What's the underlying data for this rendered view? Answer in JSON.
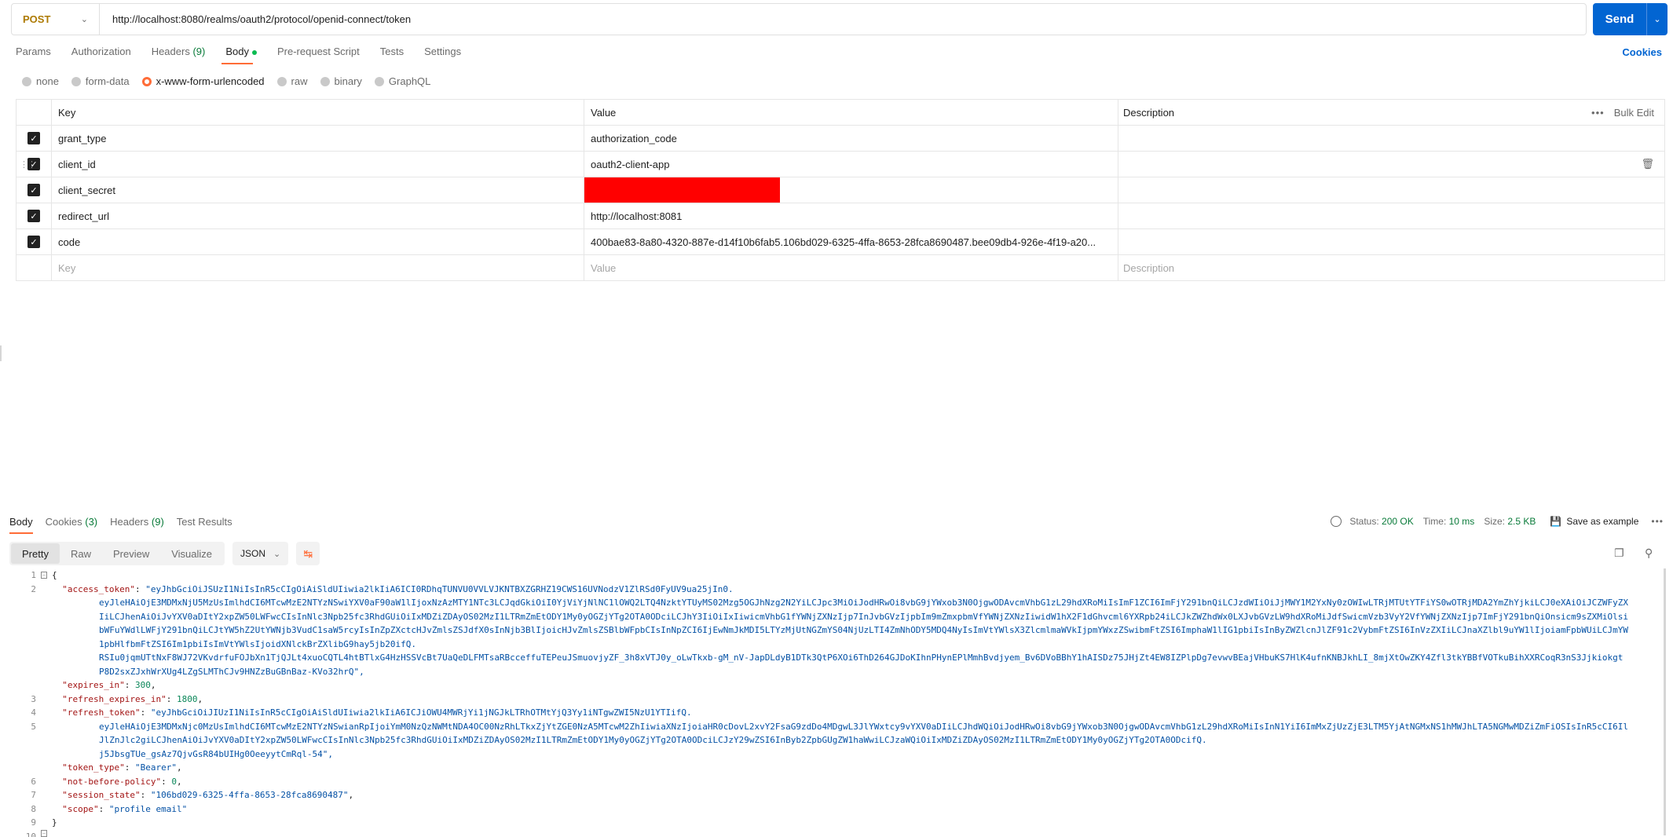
{
  "request": {
    "method": "POST",
    "url": "http://localhost:8080/realms/oauth2/protocol/openid-connect/token",
    "send_label": "Send"
  },
  "req_tabs": [
    {
      "label": "Params",
      "count": ""
    },
    {
      "label": "Authorization",
      "count": ""
    },
    {
      "label": "Headers",
      "count": "(9)"
    },
    {
      "label": "Body",
      "count": ""
    },
    {
      "label": "Pre-request Script",
      "count": ""
    },
    {
      "label": "Tests",
      "count": ""
    },
    {
      "label": "Settings",
      "count": ""
    }
  ],
  "cookies_label": "Cookies",
  "body_types": [
    "none",
    "form-data",
    "x-www-form-urlencoded",
    "raw",
    "binary",
    "GraphQL"
  ],
  "table": {
    "headers": {
      "key": "Key",
      "value": "Value",
      "description": "Description",
      "bulk_edit": "Bulk Edit"
    },
    "rows": [
      {
        "key": "grant_type",
        "value": "authorization_code",
        "description": ""
      },
      {
        "key": "client_id",
        "value": "oauth2-client-app",
        "description": ""
      },
      {
        "key": "client_secret",
        "value": "",
        "description": ""
      },
      {
        "key": "redirect_url",
        "value": "http://localhost:8081",
        "description": ""
      },
      {
        "key": "code",
        "value": "400bae83-8a80-4320-887e-d14f10b6fab5.106bd029-6325-4ffa-8653-28fca8690487.bee09db4-926e-4f19-a20...",
        "description": ""
      }
    ],
    "placeholders": {
      "key": "Key",
      "value": "Value",
      "description": "Description"
    }
  },
  "response": {
    "tabs": [
      {
        "label": "Body",
        "count": ""
      },
      {
        "label": "Cookies",
        "count": "(3)"
      },
      {
        "label": "Headers",
        "count": "(9)"
      },
      {
        "label": "Test Results",
        "count": ""
      }
    ],
    "status_label": "Status:",
    "status_value": "200 OK",
    "time_label": "Time:",
    "time_value": "10 ms",
    "size_label": "Size:",
    "size_value": "2.5 KB",
    "save_example": "Save as example",
    "views": [
      "Pretty",
      "Raw",
      "Preview",
      "Visualize"
    ],
    "format": "JSON",
    "line_numbers": [
      "1",
      "2",
      "3",
      "4",
      "5",
      "6",
      "7",
      "8",
      "9",
      "10"
    ],
    "code": {
      "open": "{",
      "access_token_key": "\"access_token\"",
      "access_token_lines": [
        "\"eyJhbGciOiJSUzI1NiIsInR5cCIgOiAiSldUIiwia2lkIiA6ICI0RDhqTUNVU0VVLVJKNTBXZGRHZ19CWS16UVNodzV1ZlRSd0FyUV9ua25jIn0.",
        "eyJleHAiOjE3MDMxNjU5MzUsImlhdCI6MTcwMzE2NTYzNSwiYXV0aF90aW1lIjoxNzAzMTY1NTc3LCJqdGkiOiI0YjViYjNlNC1lOWQ2LTQ4NzktYTUyMS02Mzg5OGJhNzg2N2YiLCJpc3MiOiJodHRwOi8vbG9jYWxob3N0OjgwODAvcmVhbG1zL29hdXRoMiIsImF1ZCI6ImFjY291bnQiLCJzdWIiOiJjMWY1M2YxNy0zOWIwLTRjMTUtYTFiYS0wOTRjMDA2YmZhYjkiLCJ0eXAiOiJCZWFyZXIiLCJhenAiOiJvYXV0aDItY2xpZW50LWFwcCIsInNlc3Npb25fc3RhdGUiOiIxMDZiZDAyOS02MzI1LTRmZmEtODY1My0yOGZjYTg2OTA0ODciLCJhY3IiOiIxIiwicmVhbG1fYWNjZXNzIjp7InJvbGVzIjpbIm9mZmxpbmVfYWNjZXNzIiwidW1hX2F1dGhvcml6YXRpb24iLCJkZWZhdWx0LXJvbGVzLW9hdXRoMiJdfSwicmVzb3VyY2VfYWNjZXNzIjp7ImFjY291bnQiOnsicm9sZXMiOlsibWFuYWdlLWFjY291bnQiLCJtYW5hZ2UtYWNjb3VudC1saW5rcyIsInZpZXctcHJvZmlsZSJdfX0sInNjb3BlIjoicHJvZmlsZSBlbWFpbCIsInNpZCI6IjEwNmJkMDI5LTYzMjUtNGZmYS04NjUzLTI4ZmNhODY5MDQ4NyIsImVtYWlsX3ZlcmlmaWVkIjpmYWxzZSwibmFtZSI6ImphaW1lIG1pbiIsInByZWZlcnJlZF91c2VybmFtZSI6InVzZXIiLCJnaXZlbl9uYW1lIjoiamFpbWUiLCJmYW1pbHlfbmFtZSI6Im1pbiIsImVtYWlsIjoidXNlckBrZXlibG9hay5jb20ifQ.",
        "RSIu0jqmUTtNxF8WJ72VKvdrfuFOJbXn1TjQJLt4xuoCQTL4htBTlxG4HzHSSVcBt7UaQeDLFMTsaRBcceffuTEPeuJSmuovjyZF_3h8xVTJ0y_oLwTkxb-gM_nV-JapDLdyB1DTk3QtP6XOi6ThD264GJDoKIhnPHynEPlMmhBvdjyem_Bv6DVoBBhY1hAISDz75JHjZt4EW8IZPlpDg7evwvBEajVHbuKS7HlK4ufnKNBJkhLI_8mjXtOwZKY4Zfl3tkYBBfVOTkuBihXXRCoqR3nS3Jjkiokgt P8D2sxZJxhWrXUg4LZgSLMThCJv9HNZzBuGBnBaz-KVo32hrQ\","
      ],
      "expires_in_key": "\"expires_in\"",
      "expires_in_value": "300",
      "refresh_expires_in_key": "\"refresh_expires_in\"",
      "refresh_expires_in_value": "1800",
      "refresh_token_key": "\"refresh_token\"",
      "refresh_token_lines": [
        "\"eyJhbGciOiJIUzI1NiIsInR5cCIgOiAiSldUIiwia2lkIiA6ICJiOWU4MWRjYi1jNGJkLTRhOTMtYjQ3Yy1iNTgwZWI5NzU1YTIifQ.",
        "eyJleHAiOjE3MDMxNjc0MzUsImlhdCI6MTcwMzE2NTYzNSwianRpIjoiYmM0NzQzNWMtNDA4OC00NzRhLTkxZjYtZGE0NzA5MTcwM2ZhIiwiaXNzIjoiaHR0cDovL2xvY2FsaG9zdDo4MDgwL3JlYWxtcy9vYXV0aDIiLCJhdWQiOiJodHRwOi8vbG9jYWxob3N0OjgwODAvcmVhbG1zL29hdXRoMiIsInN1YiI6ImMxZjUzZjE3LTM5YjAtNGMxNS1hMWJhLTA5NGMwMDZiZmFiOSIsInR5cCI6IlJlZnJlc2giLCJhenAiOiJvYXV0aDItY2xpZW50LWFwcCIsInNlc3Npb25fc3RhdGUiOiIxMDZiZDAyOS02MzI1LTRmZmEtODY1My0yOGZjYTg2OTA0ODciLCJzY29wZSI6InByb2ZpbGUgZW1haWwiLCJzaWQiOiIxMDZiZDAyOS02MzI1LTRmZmEtODY1My0yOGZjYTg2OTA0ODcifQ.",
        "j5JbsgTUe_gsAz7QjvGsR84bUIHg0OeeyytCmRql-54\","
      ],
      "token_type_key": "\"token_type\"",
      "token_type_value": "\"Bearer\"",
      "nbp_key": "\"not-before-policy\"",
      "nbp_value": "0",
      "session_state_key": "\"session_state\"",
      "session_state_value": "\"106bd029-6325-4ffa-8653-28fca8690487\"",
      "scope_key": "\"scope\"",
      "scope_value": "\"profile email\"",
      "close": "}"
    }
  },
  "colors": {
    "accent_orange": "#ff6c37",
    "send_blue": "#0265d2",
    "status_green": "#0a7b3a",
    "method_post": "#ad7a03"
  }
}
